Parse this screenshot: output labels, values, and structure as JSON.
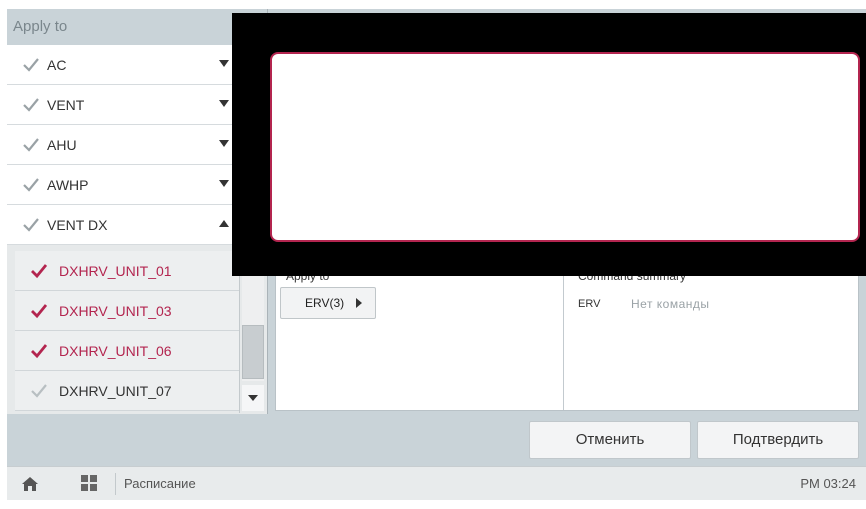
{
  "left_panel": {
    "header": "Apply to",
    "rows": [
      {
        "label": "AC",
        "expanded": false
      },
      {
        "label": "VENT",
        "expanded": false
      },
      {
        "label": "AHU",
        "expanded": false
      },
      {
        "label": "AWHP",
        "expanded": false
      },
      {
        "label": "VENT DX",
        "expanded": true
      }
    ],
    "subitems": [
      {
        "label": "DXHRV_UNIT_01",
        "selected": true
      },
      {
        "label": "DXHRV_UNIT_03",
        "selected": true
      },
      {
        "label": "DXHRV_UNIT_06",
        "selected": true
      },
      {
        "label": "DXHRV_UNIT_07",
        "selected": false
      }
    ]
  },
  "content": {
    "apply_to_label": "Apply to",
    "apply_button": "ERV(3)",
    "summary_title": "Command summary",
    "summary_key": "ERV",
    "summary_value": "Нет команды"
  },
  "buttons": {
    "cancel": "Отменить",
    "confirm": "Подтвердить"
  },
  "bottombar": {
    "title": "Расписание",
    "time": "PM 03:24"
  },
  "colors": {
    "accent": "#b3254f",
    "panel": "#c9d3d8",
    "checkmark_gray": "#9aa2a6"
  },
  "icons": [
    "checkmark-icon",
    "chevron-down-icon",
    "chevron-up-icon",
    "play-arrow-icon",
    "home-icon",
    "apps-grid-icon"
  ]
}
